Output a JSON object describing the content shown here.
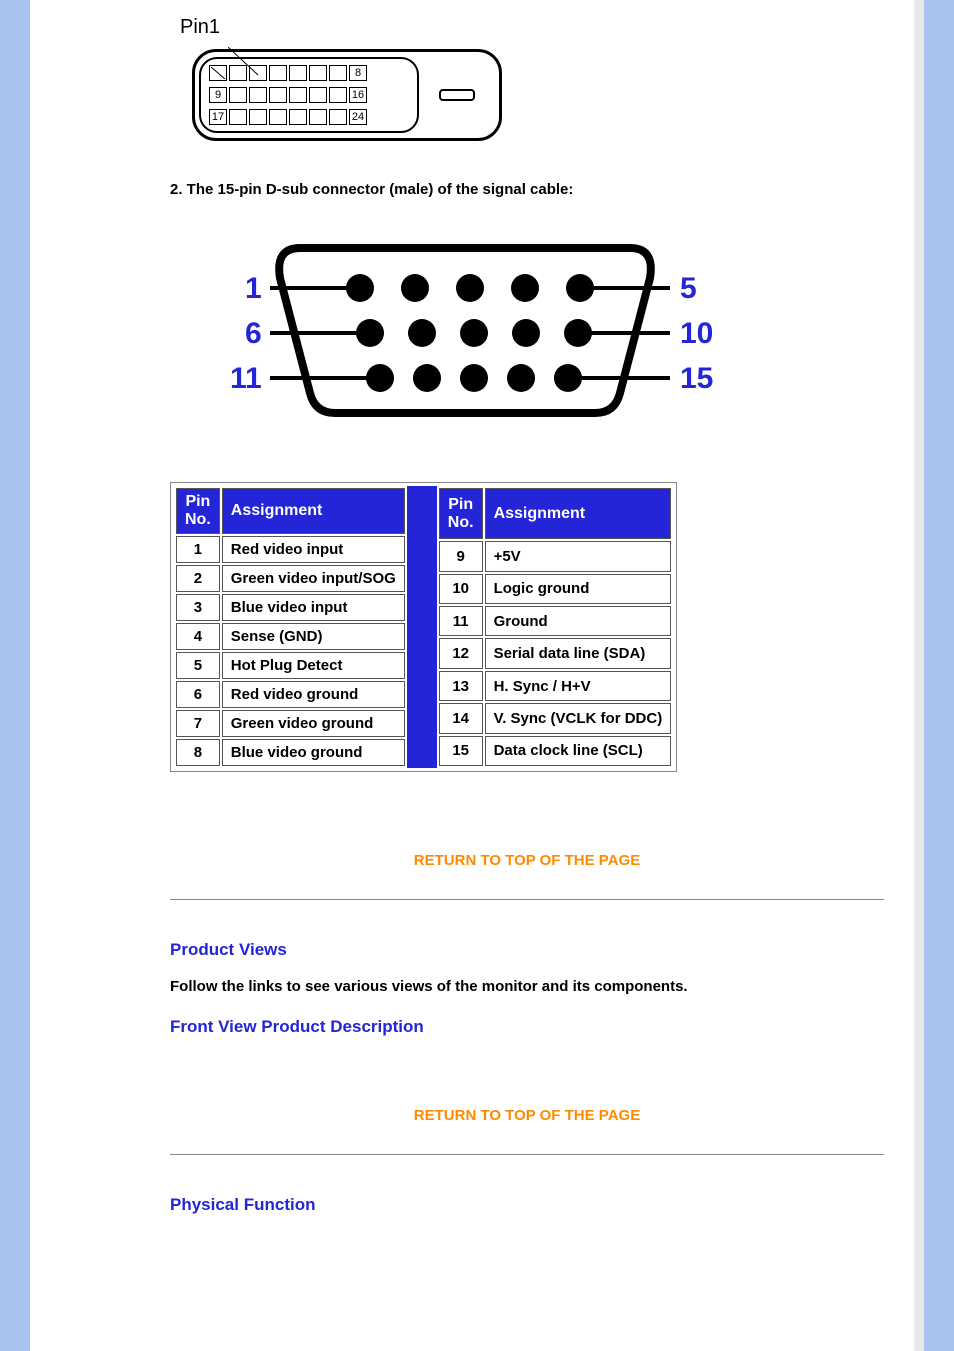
{
  "dvi": {
    "pin1_label": "Pin1",
    "row1_end": "8",
    "row2_start": "9",
    "row2_end": "16",
    "row3_start": "17",
    "row3_end": "24"
  },
  "heading_dsub": "2. The 15-pin D-sub connector (male) of the signal cable:",
  "dsub_labels": {
    "l1": "1",
    "l2": "6",
    "l3": "11",
    "r1": "5",
    "r2": "10",
    "r3": "15"
  },
  "table": {
    "headers": {
      "pin": "Pin No.",
      "assign": "Assignment"
    },
    "left": [
      {
        "n": "1",
        "a": "Red video input"
      },
      {
        "n": "2",
        "a": "Green video input/SOG"
      },
      {
        "n": "3",
        "a": "Blue video input"
      },
      {
        "n": "4",
        "a": "Sense (GND)"
      },
      {
        "n": "5",
        "a": "Hot Plug Detect"
      },
      {
        "n": "6",
        "a": "Red video ground"
      },
      {
        "n": "7",
        "a": "Green video ground"
      },
      {
        "n": "8",
        "a": "Blue video ground"
      }
    ],
    "right": [
      {
        "n": "9",
        "a": "+5V"
      },
      {
        "n": "10",
        "a": "Logic ground"
      },
      {
        "n": "11",
        "a": "Ground"
      },
      {
        "n": "12",
        "a": "Serial data line (SDA)"
      },
      {
        "n": "13",
        "a": "H. Sync / H+V"
      },
      {
        "n": "14",
        "a": "V. Sync (VCLK for DDC)"
      },
      {
        "n": "15",
        "a": "Data clock line (SCL)"
      }
    ]
  },
  "links": {
    "return_top": "RETURN TO TOP OF THE PAGE",
    "product_views_title": "Product Views",
    "product_views_text": "Follow the links to see various views of the monitor and its components.",
    "front_view": "Front View Product Description",
    "physical_function_title": "Physical Function"
  }
}
